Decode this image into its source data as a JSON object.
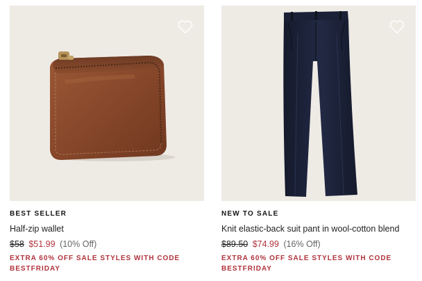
{
  "products": [
    {
      "badge": "BEST SELLER",
      "title": "Half-zip wallet",
      "price_original": "$58",
      "price_sale": "$51.99",
      "price_discount": "(10% Off)",
      "promo_line1": "EXTRA 60% OFF SALE STYLES WITH CODE",
      "promo_line2": "BESTFRIDAY",
      "image_icon": "wallet-image",
      "favorite_icon": "heart-icon"
    },
    {
      "badge": "NEW TO SALE",
      "title": "Knit elastic-back suit pant in wool-cotton blend",
      "price_original": "$89.50",
      "price_sale": "$74.99",
      "price_discount": "(16% Off)",
      "promo_line1": "EXTRA 60% OFF SALE STYLES WITH CODE",
      "promo_line2": "BESTFRIDAY",
      "image_icon": "pants-image",
      "favorite_icon": "heart-icon"
    }
  ],
  "colors": {
    "image_background": "#eeebe5",
    "sale_red": "#b0333b",
    "wallet_brown": "#8a4a2b",
    "pants_navy": "#1c2237"
  }
}
